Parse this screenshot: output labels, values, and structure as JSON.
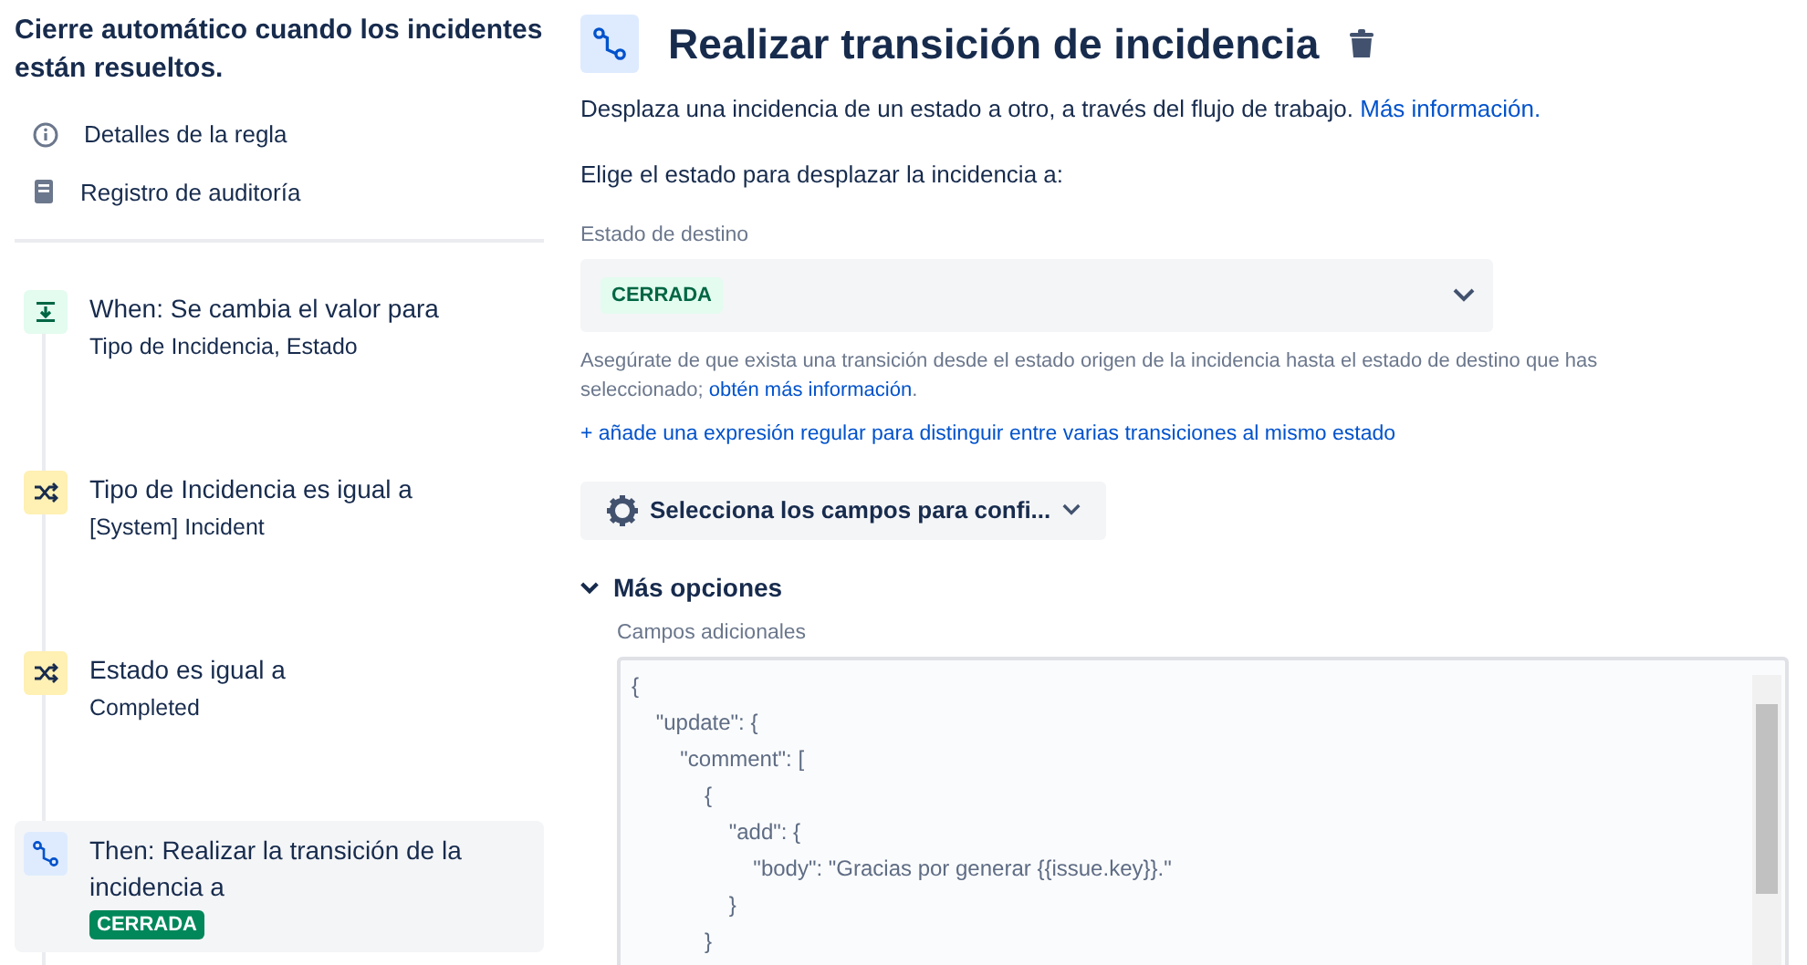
{
  "sidebar": {
    "rule_title": "Cierre automático cuando los incidentes están resueltos.",
    "links": [
      {
        "kind": "info",
        "label": "Detalles de la regla"
      },
      {
        "kind": "log",
        "label": "Registro de auditoría"
      }
    ],
    "steps": [
      {
        "kind": "trigger",
        "title": "When: Se cambia el valor para",
        "detail": "Tipo de Incidencia, Estado",
        "selected": false
      },
      {
        "kind": "condition",
        "title": "Tipo de Incidencia es igual a",
        "detail": "[System] Incident",
        "selected": false
      },
      {
        "kind": "condition",
        "title": "Estado es igual a",
        "detail": "Completed",
        "selected": false
      },
      {
        "kind": "action",
        "title": "Then: Realizar la transición de la incidencia a",
        "lozenge": "CERRADA",
        "selected": true
      }
    ]
  },
  "panel": {
    "title": "Realizar transición de incidencia",
    "description": "Desplaza una incidencia de un estado a otro, a través del flujo de trabajo.",
    "description_link": "Más información.",
    "prompt": "Elige el estado para desplazar la incidencia a:",
    "destination": {
      "label": "Estado de destino",
      "value": "CERRADA"
    },
    "help": "Asegúrate de que exista una transición desde el estado origen de la incidencia hasta el estado de destino que has seleccionado;",
    "help_link": "obtén más información",
    "help_end": ".",
    "regex_link": "+ añade una expresión regular para distinguir entre varias transiciones al mismo estado",
    "fields_button": "Selecciona los campos para confi...",
    "more_options": {
      "label": "Más opciones",
      "expanded": true,
      "additional_fields": {
        "label": "Campos adicionales",
        "value": "{\n    \"update\": {\n        \"comment\": [\n            {\n                \"add\": {\n                    \"body\": \"Gracias por generar {{issue.key}}.\"\n                }\n            }"
      }
    }
  }
}
